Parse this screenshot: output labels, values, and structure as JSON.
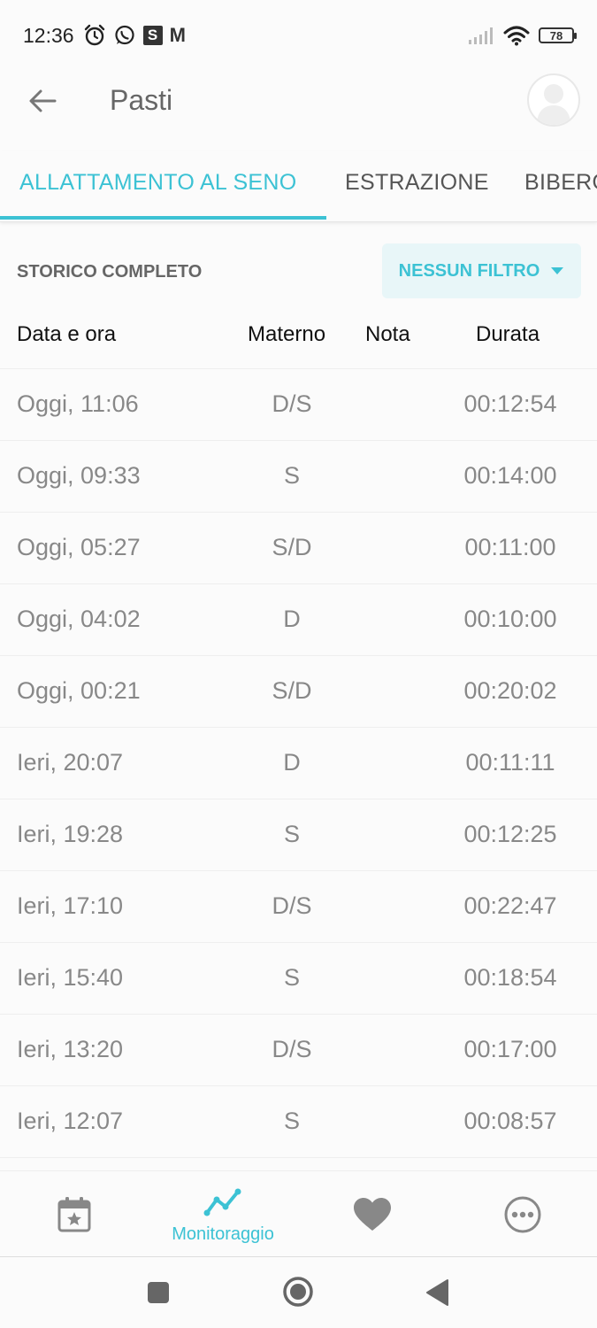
{
  "status_bar": {
    "time": "12:36",
    "battery": "78",
    "s_badge": "S",
    "mail_glyph": "M"
  },
  "app_bar": {
    "title": "Pasti"
  },
  "tabs": [
    {
      "label": "ALLATTAMENTO AL SENO",
      "active": true
    },
    {
      "label": "ESTRAZIONE",
      "active": false
    },
    {
      "label": "BIBERON",
      "active": false
    }
  ],
  "filter": {
    "history_label": "STORICO COMPLETO",
    "filter_button": "NESSUN FILTRO"
  },
  "table": {
    "headers": {
      "date": "Data e ora",
      "side": "Materno",
      "note": "Nota",
      "duration": "Durata"
    },
    "rows": [
      {
        "date": "Oggi,  11:06",
        "side": "D/S",
        "note": "",
        "duration": "00:12:54"
      },
      {
        "date": "Oggi,  09:33",
        "side": "S",
        "note": "",
        "duration": "00:14:00"
      },
      {
        "date": "Oggi,  05:27",
        "side": "S/D",
        "note": "",
        "duration": "00:11:00"
      },
      {
        "date": "Oggi,  04:02",
        "side": "D",
        "note": "",
        "duration": "00:10:00"
      },
      {
        "date": "Oggi,  00:21",
        "side": "S/D",
        "note": "",
        "duration": "00:20:02"
      },
      {
        "date": "Ieri,  20:07",
        "side": "D",
        "note": "",
        "duration": "00:11:11"
      },
      {
        "date": "Ieri,  19:28",
        "side": "S",
        "note": "",
        "duration": "00:12:25"
      },
      {
        "date": "Ieri,  17:10",
        "side": "D/S",
        "note": "",
        "duration": "00:22:47"
      },
      {
        "date": "Ieri,  15:40",
        "side": "S",
        "note": "",
        "duration": "00:18:54"
      },
      {
        "date": "Ieri,  13:20",
        "side": "D/S",
        "note": "",
        "duration": "00:17:00"
      },
      {
        "date": "Ieri,  12:07",
        "side": "S",
        "note": "",
        "duration": "00:08:57"
      }
    ]
  },
  "bottom_nav": {
    "items": [
      {
        "icon": "calendar-star-icon",
        "label": ""
      },
      {
        "icon": "trend-line-icon",
        "label": "Monitoraggio",
        "active": true
      },
      {
        "icon": "heart-icon",
        "label": ""
      },
      {
        "icon": "more-icon",
        "label": ""
      }
    ]
  },
  "colors": {
    "accent": "#3cc2d4",
    "text_muted": "#888888",
    "background": "#fbfbfb"
  }
}
